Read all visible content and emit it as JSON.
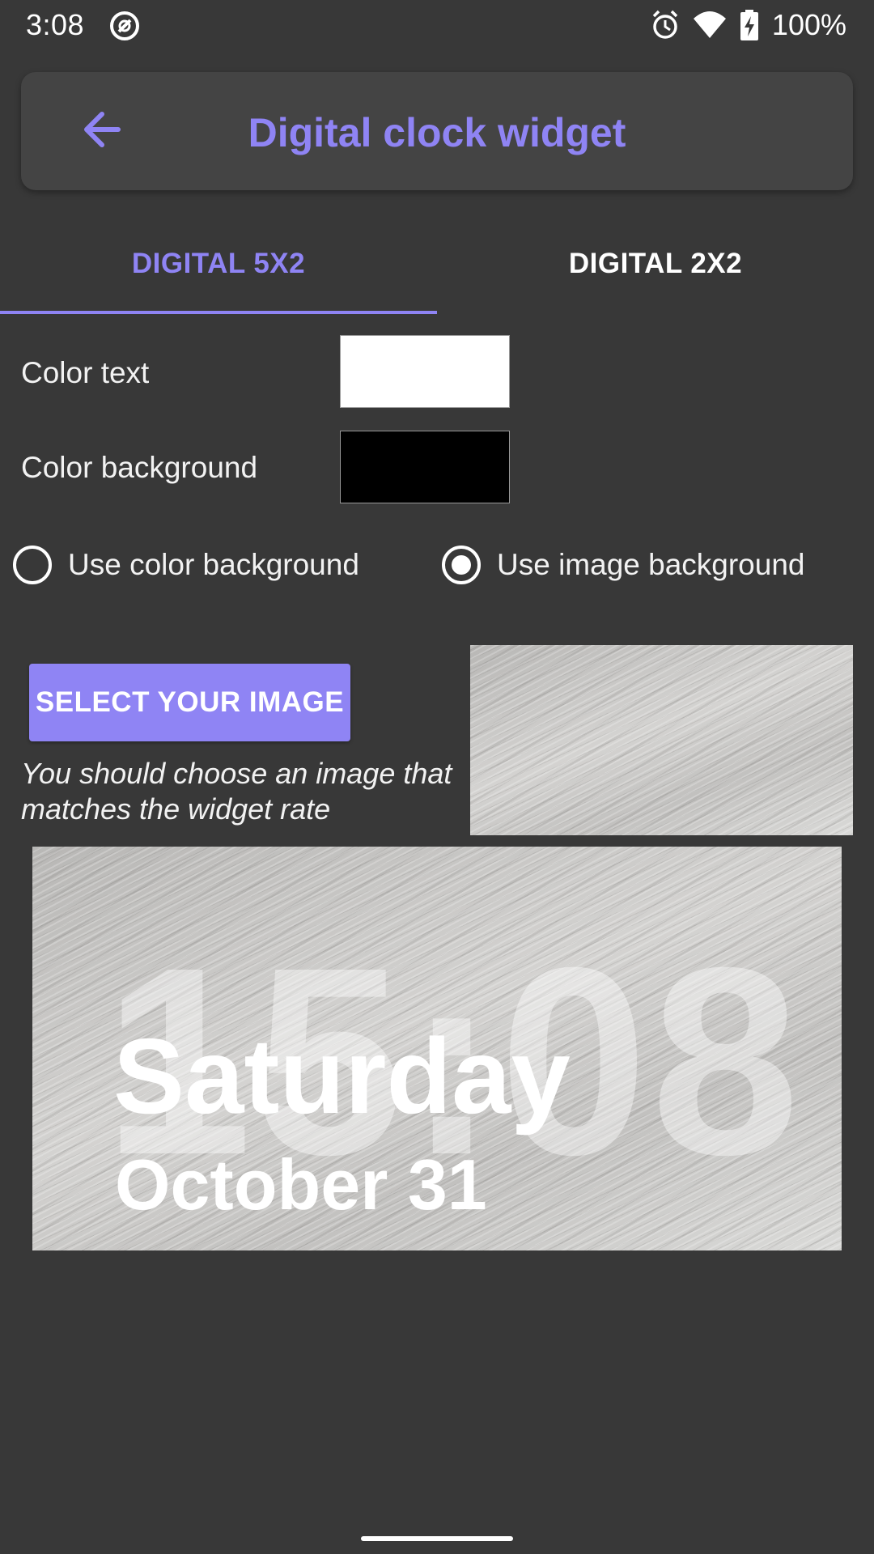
{
  "status_bar": {
    "time": "3:08",
    "battery_percent": "100%",
    "icons": [
      "app-notification-icon",
      "alarm-icon",
      "wifi-icon",
      "battery-charging-icon"
    ]
  },
  "toolbar": {
    "title": "Digital clock widget",
    "back_icon": "arrow-left-icon"
  },
  "tabs": [
    {
      "label": "DIGITAL 5X2",
      "selected": true
    },
    {
      "label": "DIGITAL 2X2",
      "selected": false
    }
  ],
  "settings": {
    "color_text_label": "Color text",
    "color_text_value": "#FFFFFF",
    "color_background_label": "Color background",
    "color_background_value": "#000000"
  },
  "background_mode": {
    "options": [
      {
        "label": "Use color background",
        "checked": false
      },
      {
        "label": "Use image background",
        "checked": true
      }
    ]
  },
  "image": {
    "select_button_label": "SELECT YOUR IMAGE",
    "hint": "You should choose an image that matches the widget rate"
  },
  "preview": {
    "time": "15:08",
    "day": "Saturday",
    "date": "October 31"
  },
  "colors": {
    "accent": "#8F84F4",
    "background": "#383838",
    "toolbar": "#444444"
  }
}
